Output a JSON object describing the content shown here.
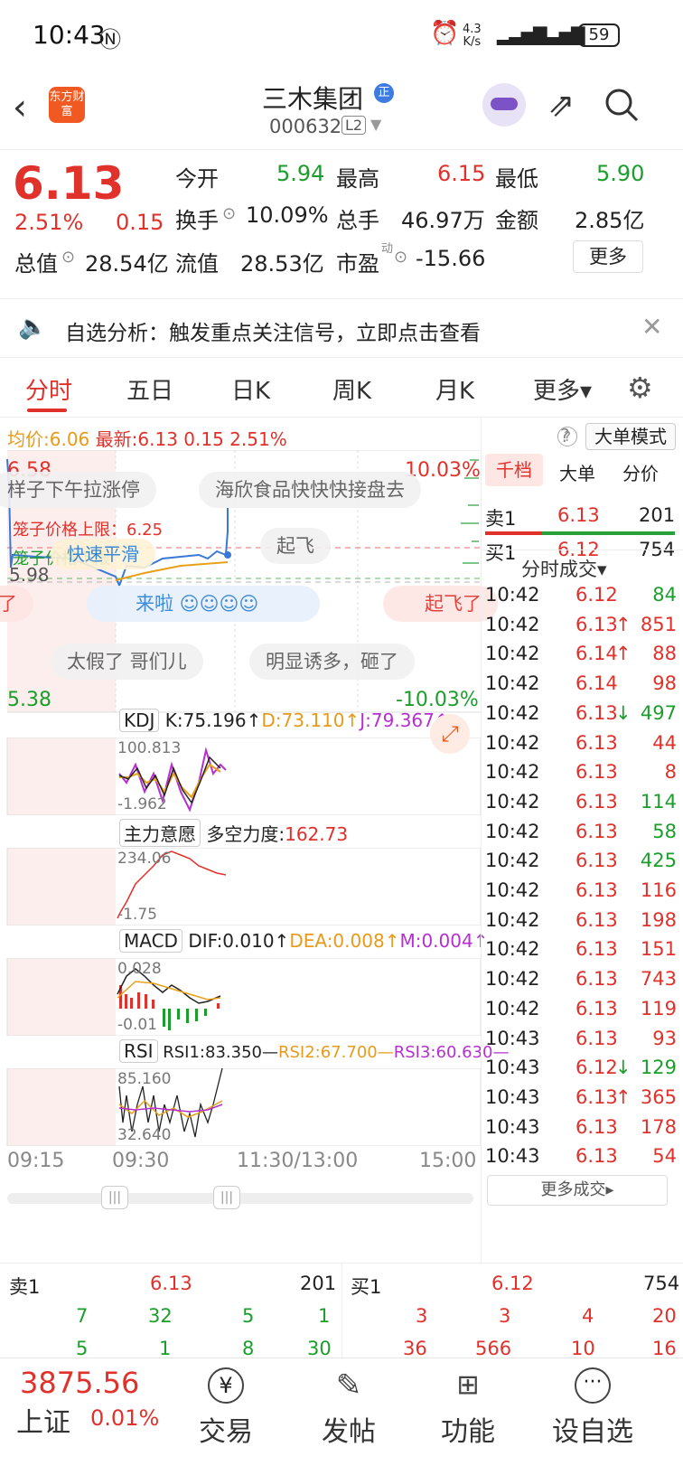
{
  "status": {
    "time": "10:43",
    "speed_top": "4.3",
    "speed_unit": "K/s",
    "battery": "59"
  },
  "header": {
    "app_logo": "东方财富",
    "title": "三木集团",
    "code": "000632",
    "level": "L2"
  },
  "quote": {
    "price": "6.13",
    "pct": "2.51%",
    "chg": "0.15",
    "open_label": "今开",
    "open": "5.94",
    "high_label": "最高",
    "high": "6.15",
    "low_label": "最低",
    "low": "5.90",
    "turnover_label": "换手",
    "turnover": "10.09%",
    "volume_label": "总手",
    "volume": "46.97万",
    "amount_label": "金额",
    "amount": "2.85亿",
    "mktcap_label": "总值",
    "mktcap": "28.54亿",
    "float_label": "流值",
    "float": "28.53亿",
    "pe_label": "市盈",
    "pe_sup": "动",
    "pe": "-15.66",
    "more": "更多"
  },
  "banner": {
    "text": "自选分析：触发重点关注信号，立即点击查看"
  },
  "tabs": [
    "分时",
    "五日",
    "日K",
    "周K",
    "月K",
    "更多▾"
  ],
  "chart": {
    "avg_label": "均价:",
    "avg": "6.06",
    "latest_label": "最新:",
    "latest": "6.13",
    "latest_chg": "0.15",
    "latest_pct": "2.51%",
    "mode_btn": "大单模式",
    "y_top": "6.58",
    "y_top_pct": "10.03%",
    "y_bottom": "5.38",
    "y_bottom_pct": "-10.03%",
    "y_mid": "5.98",
    "price_limit": "笼子价格上限：6.25",
    "price_lower": "笼子价格下限",
    "chips": [
      "样子下午拉涨停",
      "海欣食品快快快接盘去",
      "起飞",
      "来啦",
      "起飞了",
      "太假了 哥们儿",
      "明显诱多，砸了",
      "了",
      "快速平滑",
      "价格"
    ],
    "kdj": {
      "sel": "KDJ",
      "k": "K:75.196↑",
      "d": "D:73.110↑",
      "j": "J:79.367↑",
      "top": "100.813",
      "bottom": "-1.962"
    },
    "main": {
      "sel": "主力意愿",
      "label": "多空力度:",
      "val": "162.73",
      "top": "234.06",
      "bottom": "-1.75"
    },
    "macd": {
      "sel": "MACD",
      "dif": "DIF:0.010↑",
      "dea": "DEA:0.008↑",
      "m": "M:0.004↑",
      "top": "0.028",
      "bottom": "-0.01"
    },
    "rsi": {
      "sel": "RSI",
      "r1": "RSI1:83.350—",
      "r2": "RSI2:67.700—",
      "r3": "RSI3:60.630—",
      "top": "85.160",
      "bottom": "32.640"
    },
    "xaxis": [
      "09:15",
      "09:30",
      "11:30/13:00",
      "15:00"
    ]
  },
  "right": {
    "tabs": [
      "千档",
      "大单",
      "分价"
    ],
    "sell1_label": "卖1",
    "sell1_price": "6.13",
    "sell1_vol": "201",
    "buy1_label": "买1",
    "buy1_price": "6.12",
    "buy1_vol": "754",
    "ticks_title": "分时成交▾",
    "ticks": [
      {
        "t": "10:42",
        "p": "6.12",
        "a": "",
        "v": "84",
        "pc": "red",
        "vc": "green"
      },
      {
        "t": "10:42",
        "p": "6.13",
        "a": "↑",
        "v": "851",
        "pc": "red",
        "vc": "red"
      },
      {
        "t": "10:42",
        "p": "6.14",
        "a": "↑",
        "v": "88",
        "pc": "red",
        "vc": "red"
      },
      {
        "t": "10:42",
        "p": "6.14",
        "a": "",
        "v": "98",
        "pc": "red",
        "vc": "red"
      },
      {
        "t": "10:42",
        "p": "6.13",
        "a": "↓",
        "v": "497",
        "pc": "red",
        "vc": "green"
      },
      {
        "t": "10:42",
        "p": "6.13",
        "a": "",
        "v": "44",
        "pc": "red",
        "vc": "red"
      },
      {
        "t": "10:42",
        "p": "6.13",
        "a": "",
        "v": "8",
        "pc": "red",
        "vc": "red"
      },
      {
        "t": "10:42",
        "p": "6.13",
        "a": "",
        "v": "114",
        "pc": "red",
        "vc": "green"
      },
      {
        "t": "10:42",
        "p": "6.13",
        "a": "",
        "v": "58",
        "pc": "red",
        "vc": "green"
      },
      {
        "t": "10:42",
        "p": "6.13",
        "a": "",
        "v": "425",
        "pc": "red",
        "vc": "green"
      },
      {
        "t": "10:42",
        "p": "6.13",
        "a": "",
        "v": "116",
        "pc": "red",
        "vc": "red"
      },
      {
        "t": "10:42",
        "p": "6.13",
        "a": "",
        "v": "198",
        "pc": "red",
        "vc": "red"
      },
      {
        "t": "10:42",
        "p": "6.13",
        "a": "",
        "v": "151",
        "pc": "red",
        "vc": "red"
      },
      {
        "t": "10:42",
        "p": "6.13",
        "a": "",
        "v": "743",
        "pc": "red",
        "vc": "red"
      },
      {
        "t": "10:42",
        "p": "6.13",
        "a": "",
        "v": "119",
        "pc": "red",
        "vc": "red"
      },
      {
        "t": "10:43",
        "p": "6.13",
        "a": "",
        "v": "93",
        "pc": "red",
        "vc": "red"
      },
      {
        "t": "10:43",
        "p": "6.12",
        "a": "↓",
        "v": "129",
        "pc": "red",
        "vc": "green"
      },
      {
        "t": "10:43",
        "p": "6.13",
        "a": "↑",
        "v": "365",
        "pc": "red",
        "vc": "red"
      },
      {
        "t": "10:43",
        "p": "6.13",
        "a": "",
        "v": "178",
        "pc": "red",
        "vc": "red"
      },
      {
        "t": "10:43",
        "p": "6.13",
        "a": "",
        "v": "54",
        "pc": "red",
        "vc": "red"
      }
    ],
    "more": "更多成交▸"
  },
  "orderbook": {
    "sell1_label": "卖1",
    "sell1_price": "6.13",
    "sell1_vol": "201",
    "buy1_label": "买1",
    "buy1_price": "6.12",
    "buy1_vol": "754",
    "sell_row1": [
      "7",
      "32",
      "5",
      "1"
    ],
    "sell_row2": [
      "5",
      "1",
      "8",
      "30"
    ],
    "buy_row1": [
      "3",
      "3",
      "4",
      "20"
    ],
    "buy_row2": [
      "36",
      "566",
      "10",
      "16"
    ]
  },
  "nav": {
    "index_val": "3875.56",
    "index_name": "上证",
    "index_pct": "0.01%",
    "items": [
      "交易",
      "发帖",
      "功能",
      "设自选"
    ]
  }
}
